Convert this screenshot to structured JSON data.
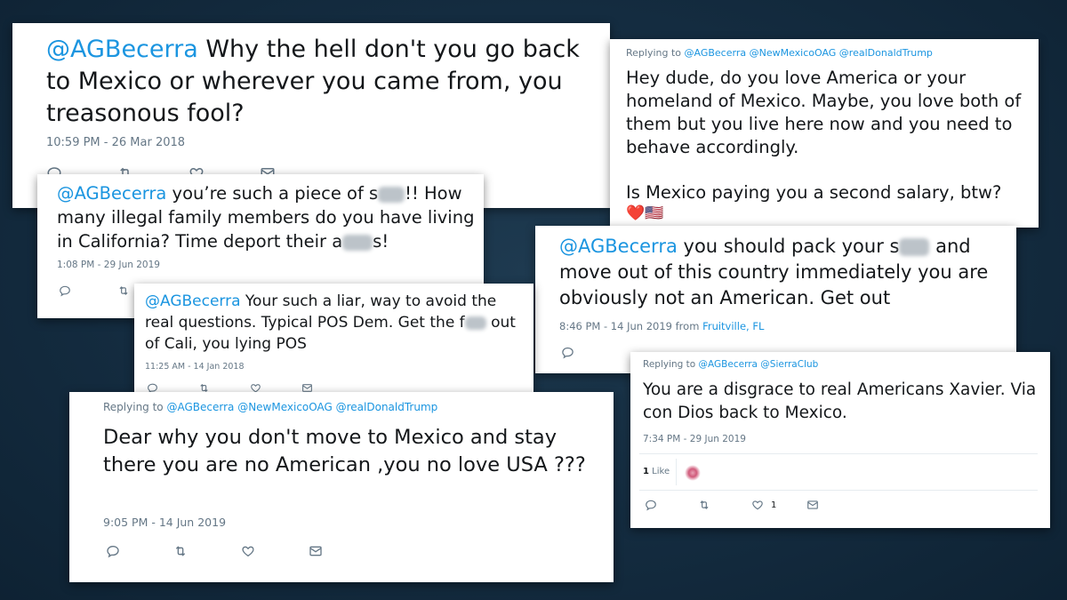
{
  "tweets": [
    {
      "mention": "@AGBecerra",
      "text": " Why the hell don't you go back to Mexico or wherever you came from, you treasonous fool?",
      "timestamp": "10:59 PM - 26 Mar 2018"
    },
    {
      "reply_label": "Replying to",
      "reply_mentions": "@AGBecerra @NewMexicoOAG @realDonaldTrump",
      "text": "Hey dude, do you love America or your homeland of Mexico. Maybe, you love both of them but you live here now and you need to behave accordingly.",
      "text2": "Is Mexico paying you a second salary, btw?",
      "emoji": "❤️🇺🇸"
    },
    {
      "mention": "@AGBecerra",
      "text_a": " you’re such a piece of s",
      "text_b": "!! How many illegal family members do you have living in California? Time deport their a",
      "text_c": "s!",
      "timestamp": "1:08 PM - 29 Jun 2019"
    },
    {
      "mention": "@AGBecerra",
      "text_a": " you should pack your s",
      "text_b": " and move out of this country immediately you are obviously not an American.  Get out",
      "timestamp": "8:46 PM - 14 Jun 2019 from ",
      "location": "Fruitville, FL"
    },
    {
      "mention": "@AGBecerra",
      "text_a": " Your such a liar, way to avoid the real questions. Typical POS Dem. Get the f",
      "text_b": " out of Cali, you lying POS",
      "timestamp": "11:25 AM - 14 Jan 2018"
    },
    {
      "reply_label": "Replying to",
      "reply_mentions": "@AGBecerra @SierraClub",
      "text": "You are a disgrace to real Americans Xavier. Via con Dios back to Mexico.",
      "timestamp": "7:34 PM - 29 Jun 2019",
      "likes_count": "1",
      "likes_label": "Like",
      "like_action_count": "1"
    },
    {
      "reply_label": "Replying to",
      "reply_mentions": "@AGBecerra @NewMexicoOAG @realDonaldTrump",
      "text": "Dear why you don't move to Mexico  and stay there you are no American ,you no love USA ???",
      "timestamp": "9:05 PM - 14 Jun 2019"
    }
  ],
  "icons": [
    "reply-icon",
    "retweet-icon",
    "like-icon",
    "dm-icon"
  ],
  "colors": {
    "background": "#142c40",
    "link": "#1b95e0",
    "muted": "#657786"
  }
}
